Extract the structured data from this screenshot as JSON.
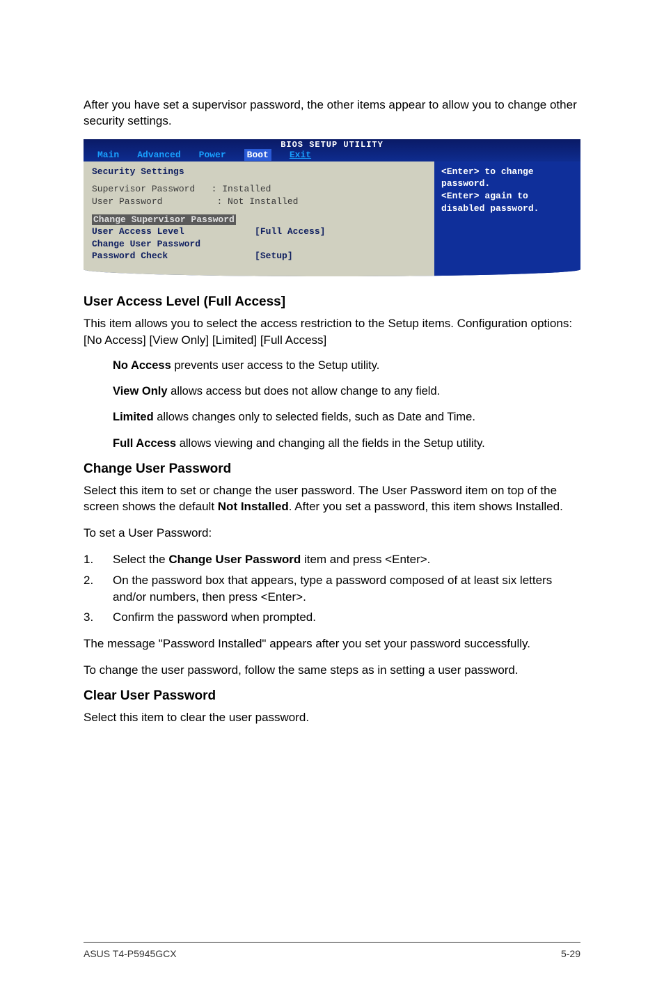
{
  "intro": "After you have set a supervisor password, the other items appear to allow you to change other security settings.",
  "bios": {
    "title": "BIOS SETUP UTILITY",
    "tabs": {
      "main": "Main",
      "advanced": "Advanced",
      "power": "Power",
      "boot": "Boot",
      "exit": "Exit"
    },
    "left": {
      "heading": "Security Settings",
      "supLabel": "Supervisor Password",
      "supVal": ": Installed",
      "userLabel": "User Password",
      "userVal": ": Not Installed",
      "changeSup": "Change Supervisor Password",
      "accessLabel": "User Access Level",
      "accessVal": "[Full Access]",
      "changeUser": "Change User Password",
      "checkLabel": "Password Check",
      "checkVal": "[Setup]"
    },
    "right": {
      "l1": "<Enter> to change",
      "l2": "password.",
      "l3": "<Enter> again to",
      "l4": "disabled password."
    }
  },
  "s1": {
    "h": "User Access Level (Full Access]",
    "p": "This item allows you to select the access restriction to the Setup items. Configuration options: [No Access] [View Only] [Limited] [Full Access]",
    "opts": [
      {
        "b": "No Access",
        "t": " prevents user access to the Setup utility."
      },
      {
        "b": "View Only",
        "t": " allows access but does not allow change to any field."
      },
      {
        "b": "Limited",
        "t": " allows changes only to selected fields, such as Date and Time."
      },
      {
        "b": "Full Access",
        "t": " allows viewing and changing all the fields in the Setup utility."
      }
    ]
  },
  "s2": {
    "h": "Change User Password",
    "p1a": "Select this item to set or change the user password. The User Password item on top of the screen shows the default ",
    "p1b": "Not Installed",
    "p1c": ". After you set a password, this item shows Installed.",
    "p2": "To set a User Password:",
    "steps": [
      {
        "n": "1.",
        "pre": "Select the ",
        "b": "Change User Password",
        "post": " item and press <Enter>."
      },
      {
        "n": "2.",
        "pre": "On the password box that appears, type a password composed of at least six letters and/or numbers, then press <Enter>.",
        "b": "",
        "post": ""
      },
      {
        "n": "3.",
        "pre": "Confirm the password when prompted.",
        "b": "",
        "post": ""
      }
    ],
    "p3": "The message \"Password Installed\" appears after you set your password successfully.",
    "p4": "To change the user password, follow the same steps as in setting a user password."
  },
  "s3": {
    "h": "Clear User Password",
    "p": "Select this item to clear the user password."
  },
  "footer": {
    "left": "ASUS T4-P5945GCX",
    "right": "5-29"
  }
}
